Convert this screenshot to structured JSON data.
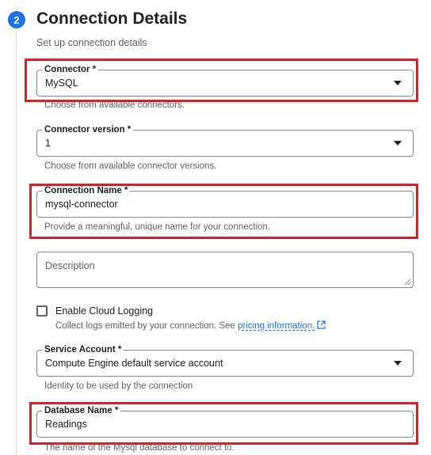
{
  "step": {
    "number": "2",
    "title": "Connection Details",
    "subtitle": "Set up connection details"
  },
  "connector": {
    "label": "Connector *",
    "value": "MySQL",
    "hint": "Choose from available connectors."
  },
  "connector_version": {
    "label": "Connector version *",
    "value": "1",
    "hint": "Choose from available connector versions."
  },
  "connection_name": {
    "label": "Connection Name *",
    "value": "mysql-connector",
    "hint": "Provide a meaningful, unique name for your connection."
  },
  "description": {
    "placeholder": "Description"
  },
  "cloud_logging": {
    "label": "Enable Cloud Logging",
    "description": "Collect logs emitted by your connection. See",
    "link_text": "pricing information.",
    "checked": false
  },
  "service_account": {
    "label": "Service Account *",
    "value": "Compute Engine default service account",
    "hint": "Identity to be used by the connection"
  },
  "database_name": {
    "label": "Database Name *",
    "value": "Readings",
    "hint": "The name of the Mysql database to connect to."
  },
  "colors": {
    "accent": "#1a73e8",
    "highlight": "#d3202a",
    "text": "#202124",
    "secondary_text": "#5f6368",
    "border": "#80868b"
  }
}
